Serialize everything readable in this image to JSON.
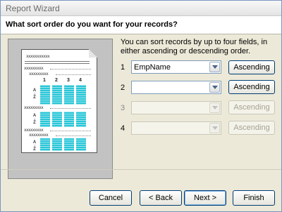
{
  "window": {
    "title": "Report Wizard"
  },
  "header": {
    "question": "What sort order do you want for your records?"
  },
  "info": {
    "text_pre": "You can sort ",
    "text_bold": "records by up to four fields, in either ascending or descending order.",
    "full": "You can sort records by up to four fields, in either ascending or descending order."
  },
  "preview": {
    "title_x": "xxxxxxxxxxx",
    "group1": "xxxxxxxxx",
    "group2": "xxxxxxxxx",
    "detail1": "xxxxxxxxx",
    "detail2": "xxxxxxxxx",
    "detail3": "xxxxxxxxx",
    "detail4": "xxxxxxxxx",
    "col_nums": [
      "1",
      "2",
      "3",
      "4"
    ],
    "az": "A",
    "za": "Z"
  },
  "sort_rows": [
    {
      "num": "1",
      "field": "EmpName",
      "order": "Ascending",
      "enabled": true
    },
    {
      "num": "2",
      "field": "",
      "order": "Ascending",
      "enabled": true
    },
    {
      "num": "3",
      "field": "",
      "order": "Ascending",
      "enabled": false
    },
    {
      "num": "4",
      "field": "",
      "order": "Ascending",
      "enabled": false
    }
  ],
  "buttons": {
    "cancel": "Cancel",
    "back": "< Back",
    "next": "Next >",
    "finish": "Finish"
  },
  "colors": {
    "accent": "#003c74",
    "preview_fill": "#28c6d8"
  }
}
